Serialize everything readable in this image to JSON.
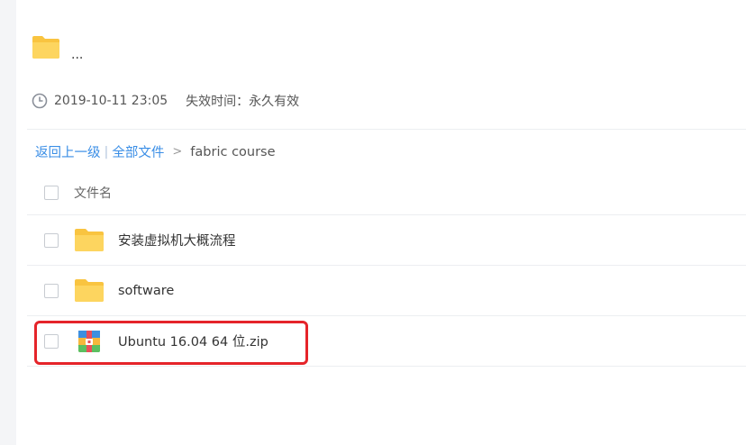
{
  "share": {
    "title": "...",
    "date": "2019-10-11 23:05",
    "expire_label": "失效时间：永久有效"
  },
  "breadcrumb": {
    "back": "返回上一级",
    "separator": "|",
    "all_files": "全部文件",
    "arrow": ">",
    "current": "fabric course"
  },
  "list": {
    "header": "文件名",
    "items": [
      {
        "name": "安装虚拟机大概流程",
        "icon": "folder-icon"
      },
      {
        "name": "software",
        "icon": "folder-icon"
      },
      {
        "name": "Ubuntu 16.04 64 位.zip",
        "icon": "zip-archive-icon"
      }
    ]
  },
  "colors": {
    "link": "#3a8ee6",
    "folder": "#fcce56",
    "highlight": "#e5242a"
  }
}
